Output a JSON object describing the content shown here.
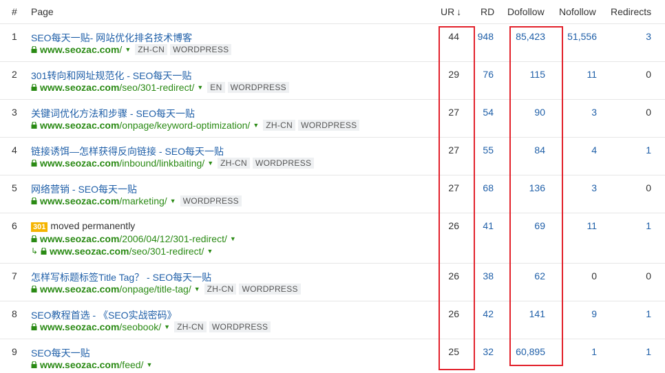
{
  "header": {
    "num": "#",
    "page": "Page",
    "ur": "UR",
    "ur_sort": "↓",
    "rd": "RD",
    "dofollow": "Dofollow",
    "nofollow": "Nofollow",
    "redirects": "Redirects"
  },
  "rows": [
    {
      "num": "1",
      "title": "SEO每天一贴- 网站优化排名技术博客",
      "host": "www.seozac.com",
      "path": "/",
      "tags": [
        "ZH-CN",
        "WORDPRESS"
      ],
      "ur": "44",
      "rd": "948",
      "dofollow": "85,423",
      "nofollow": "51,556",
      "redirects": "3"
    },
    {
      "num": "2",
      "title": "301转向和网址规范化 - SEO每天一贴",
      "host": "www.seozac.com",
      "path": "/seo/301-redirect/",
      "tags": [
        "EN",
        "WORDPRESS"
      ],
      "ur": "29",
      "rd": "76",
      "dofollow": "115",
      "nofollow": "11",
      "redirects": "0"
    },
    {
      "num": "3",
      "title": "关键词优化方法和步骤 - SEO每天一贴",
      "host": "www.seozac.com",
      "path": "/onpage/keyword-optimization/",
      "tags": [
        "ZH-CN",
        "WORDPRESS"
      ],
      "ur": "27",
      "rd": "54",
      "dofollow": "90",
      "nofollow": "3",
      "redirects": "0"
    },
    {
      "num": "4",
      "title": "链接诱饵—怎样获得反向链接 - SEO每天一贴",
      "host": "www.seozac.com",
      "path": "/inbound/linkbaiting/",
      "tags": [
        "ZH-CN",
        "WORDPRESS"
      ],
      "ur": "27",
      "rd": "55",
      "dofollow": "84",
      "nofollow": "4",
      "redirects": "1"
    },
    {
      "num": "5",
      "title": "网络营销 - SEO每天一贴",
      "host": "www.seozac.com",
      "path": "/marketing/",
      "tags": [
        "WORDPRESS"
      ],
      "ur": "27",
      "rd": "68",
      "dofollow": "136",
      "nofollow": "3",
      "redirects": "0"
    },
    {
      "num": "6",
      "badge": "301",
      "title": "moved permanently",
      "host": "www.seozac.com",
      "path": "/2006/04/12/301-redirect/",
      "redirect_host": "www.seozac.com",
      "redirect_path": "/seo/301-redirect/",
      "ur": "26",
      "rd": "41",
      "dofollow": "69",
      "nofollow": "11",
      "redirects": "1"
    },
    {
      "num": "7",
      "title": "怎样写标题标签Title Tag？ - SEO每天一贴",
      "host": "www.seozac.com",
      "path": "/onpage/title-tag/",
      "tags": [
        "ZH-CN",
        "WORDPRESS"
      ],
      "ur": "26",
      "rd": "38",
      "dofollow": "62",
      "nofollow": "0",
      "redirects": "0"
    },
    {
      "num": "8",
      "title": "SEO教程首选 - 《SEO实战密码》",
      "host": "www.seozac.com",
      "path": "/seobook/",
      "tags": [
        "ZH-CN",
        "WORDPRESS"
      ],
      "ur": "26",
      "rd": "42",
      "dofollow": "141",
      "nofollow": "9",
      "redirects": "1"
    },
    {
      "num": "9",
      "title": "SEO每天一贴",
      "host": "www.seozac.com",
      "path": "/feed/",
      "tags": [],
      "ur": "25",
      "rd": "32",
      "dofollow": "60,895",
      "nofollow": "1",
      "redirects": "1"
    }
  ],
  "icons": {
    "lock": "lock-icon",
    "caret": "caret-down-icon",
    "redirect": "redirect-arrow-icon",
    "sort": "sort-down-arrow"
  },
  "colors": {
    "link": "#1f5fa8",
    "url": "#2a8a14",
    "highlight": "#e2202a",
    "badge": "#f5b400"
  }
}
